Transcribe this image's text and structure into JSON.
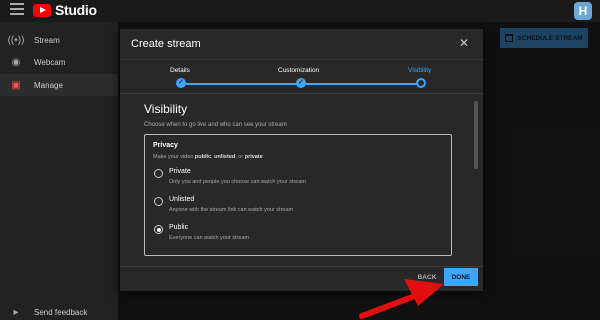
{
  "app": {
    "name": "Studio"
  },
  "avatar": {
    "letter": "H",
    "color": "#6ea6d8"
  },
  "sidebar": {
    "items": [
      {
        "label": "Stream",
        "icon": "broadcast-icon"
      },
      {
        "label": "Webcam",
        "icon": "camera-icon"
      },
      {
        "label": "Manage",
        "icon": "calendar-icon"
      }
    ],
    "feedback": "Send feedback"
  },
  "schedule_button": "SCHEDULE STREAM",
  "dialog": {
    "title": "Create stream",
    "steps": [
      {
        "label": "Details",
        "state": "done"
      },
      {
        "label": "Customization",
        "state": "done"
      },
      {
        "label": "Visibility",
        "state": "current"
      }
    ],
    "section_title": "Visibility",
    "section_subtitle": "Choose when to go live and who can see your stream",
    "privacy": {
      "title": "Privacy",
      "subtitle_prefix": "Make your video ",
      "subtitle_public": "public",
      "subtitle_sep1": ", ",
      "subtitle_unlisted": "unlisted",
      "subtitle_sep2": ", or ",
      "subtitle_private": "private",
      "options": [
        {
          "label": "Private",
          "description": "Only you and people you choose can watch your stream",
          "checked": false
        },
        {
          "label": "Unlisted",
          "description": "Anyone with the stream link can watch your stream",
          "checked": false
        },
        {
          "label": "Public",
          "description": "Everyone can watch your stream",
          "checked": true
        }
      ]
    },
    "back_label": "BACK",
    "done_label": "DONE"
  },
  "colors": {
    "accent": "#3ea6ff",
    "brand": "#ff0000",
    "arrow": "#e01010"
  }
}
